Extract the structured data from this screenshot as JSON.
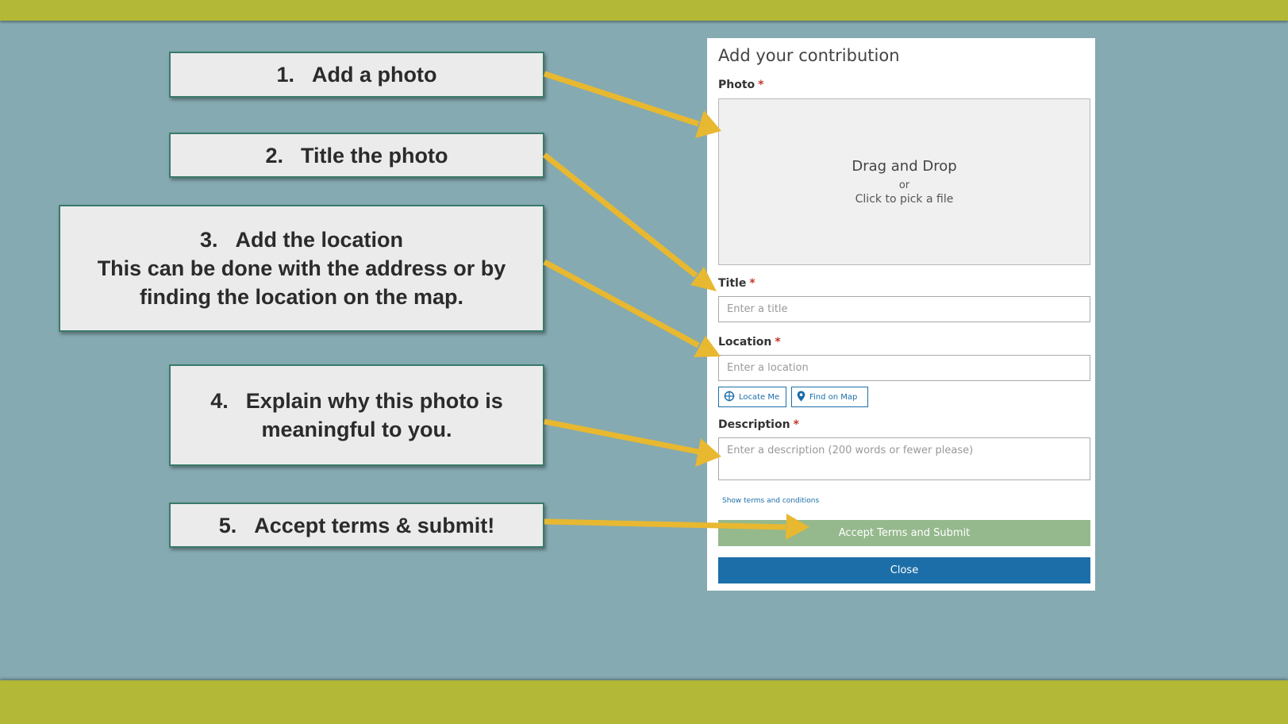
{
  "steps": [
    {
      "num": "1.",
      "text": "Add a photo",
      "text2": ""
    },
    {
      "num": "2.",
      "text": "Title the photo",
      "text2": ""
    },
    {
      "num": "3.",
      "text": "Add the location",
      "text2": "This can be done with the address or by finding the location on the map."
    },
    {
      "num": "4.",
      "text": "Explain why this photo is meaningful to you.",
      "text2": ""
    },
    {
      "num": "5.",
      "text": "Accept terms & submit!",
      "text2": ""
    }
  ],
  "form": {
    "title": "Add your contribution",
    "photo_label": "Photo",
    "required_mark": "*",
    "dropzone": {
      "main": "Drag and Drop",
      "or": "or",
      "click": "Click to pick a file"
    },
    "title_label": "Title",
    "title_placeholder": "Enter a title",
    "location_label": "Location",
    "location_placeholder": "Enter a location",
    "locate_me": "Locate Me",
    "find_on_map": "Find on Map",
    "description_label": "Description",
    "description_placeholder": "Enter a description (200 words or fewer please)",
    "terms_link": "Show terms and conditions",
    "submit_label": "Accept Terms and Submit",
    "close_label": "Close"
  },
  "colors": {
    "background": "#85aab1",
    "band": "#b3b836",
    "arrow": "#e8b830",
    "callout_border": "#3a7a6a",
    "submit_button": "#95b98d",
    "close_button": "#1b6ea8"
  },
  "icons": {
    "locate": "crosshair-icon",
    "map": "map-pin-icon"
  }
}
